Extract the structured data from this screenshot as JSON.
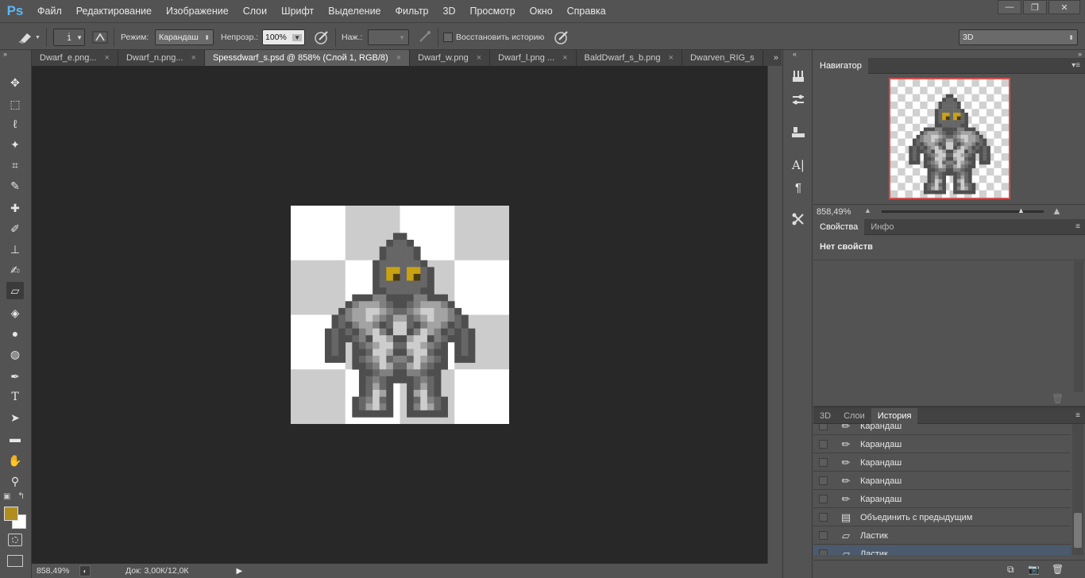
{
  "app": {
    "logo": "Ps"
  },
  "menu": [
    "Файл",
    "Редактирование",
    "Изображение",
    "Слои",
    "Шрифт",
    "Выделение",
    "Фильтр",
    "3D",
    "Просмотр",
    "Окно",
    "Справка"
  ],
  "window_controls": {
    "minimize": "—",
    "restore": "❐",
    "close": "✕"
  },
  "options": {
    "brush_size": "1",
    "mode_label": "Режим:",
    "mode_value": "Карандаш",
    "opacity_label": "Непрозр.:",
    "opacity_value": "100%",
    "pressure_label": "Наж.:",
    "pressure_value": "",
    "restore_history_label": "Восстановить историю",
    "restore_history_checked": false,
    "workspace": "3D"
  },
  "tabs": [
    {
      "label": "Dwarf_e.png...",
      "active": false
    },
    {
      "label": "Dwarf_n.png...",
      "active": false
    },
    {
      "label": "Spessdwarf_s.psd @ 858% (Слой 1, RGB/8)",
      "active": true
    },
    {
      "label": "Dwarf_w.png",
      "active": false
    },
    {
      "label": "Dwarf_l.png ...",
      "active": false
    },
    {
      "label": "BaldDwarf_s_b.png",
      "active": false
    },
    {
      "label": "Dwarven_RIG_s",
      "active": false
    }
  ],
  "tabs_overflow": "»",
  "status": {
    "zoom": "858,49%",
    "doc": "Док: 3,00К/12,0К"
  },
  "colors": {
    "foreground": "#b08d1e",
    "background": "#ffffff",
    "accent_selected": "#4c5a6e"
  },
  "navigator": {
    "tab": "Навигатор",
    "zoom": "858,49%",
    "zoom_slider_fraction": 0.86
  },
  "properties": {
    "tabs": [
      "Свойства",
      "Инфо"
    ],
    "empty_text": "Нет свойств"
  },
  "history": {
    "tabs": [
      "3D",
      "Слои",
      "История"
    ],
    "items": [
      {
        "label": "Карандаш",
        "icon": "pencil-icon",
        "selected": false
      },
      {
        "label": "Карандаш",
        "icon": "pencil-icon",
        "selected": false
      },
      {
        "label": "Карандаш",
        "icon": "pencil-icon",
        "selected": false
      },
      {
        "label": "Карандаш",
        "icon": "pencil-icon",
        "selected": false
      },
      {
        "label": "Карандаш",
        "icon": "pencil-icon",
        "selected": false
      },
      {
        "label": "Объединить с предыдущим",
        "icon": "document-icon",
        "selected": false
      },
      {
        "label": "Ластик",
        "icon": "eraser-icon",
        "selected": false
      },
      {
        "label": "Ластик",
        "icon": "eraser-icon",
        "selected": true
      }
    ]
  },
  "tools": [
    "move-tool",
    "marquee-tool",
    "lasso-tool",
    "magic-wand-tool",
    "crop-tool",
    "eyedropper-tool",
    "healing-brush-tool",
    "brush-tool",
    "clone-stamp-tool",
    "history-brush-tool",
    "eraser-tool",
    "paint-bucket-tool",
    "blur-tool",
    "dodge-tool",
    "pen-tool",
    "type-tool",
    "path-selection-tool",
    "rectangle-tool",
    "hand-tool",
    "zoom-tool"
  ],
  "sprite": {
    "palette": {
      "K": "#3a3a3a",
      "D": "#4e4e4e",
      "M": "#666666",
      "G": "#808080",
      "L": "#a3a3a3",
      "W": "#cdcdcd",
      "Y": "#c9a212",
      "B": "#4a3a10"
    },
    "rows": [
      "..........................",
      "..........................",
      "..........................",
      "..........................",
      "............DD............",
      "...........DMMD...........",
      "..........DMMMMD..........",
      "..........DMMMMD..........",
      ".........DMMMMMMD.........",
      ".........DMYYMYYMD........",
      ".........DMYBMYBMD........",
      ".........DMMMMMMMD........",
      ".........DDMMMMMDD........",
      "......DDDGGDDDDGGDDD......",
      ".....DGLLLGMDDMGLLLGD.....",
      "....DGLLWWLGMMGLWWLLGD....",
      "...DMGLLWLGMLLMGLWLLGMD...",
      "...DMDGLLGDMWWMDGLLGDMD...",
      "..DMDMDGLWGDWWDGWLGDMDMD..",
      "..DMDDMGDWWLDDLWWDGMDDMD..",
      "..DMD.DMGLWWMMWWLGMD.DMD..",
      "..DMD.DDMWWLDDLWWMDD.DMD..",
      "..DDD.DMGLWMGGMWLGMD.DDD..",
      "......DDMGWLMMLWGMDD......",
      ".......DDMGGDDGGMDD.......",
      ".......DMGMDDDDMGMD.......",
      ".......DMLMD..DMLMD.......",
      ".......DMWLD..DLWMD.......",
      "......DMGWMD..DMWGMD......",
      "......DMLWGD..DGWLMD......",
      "......DDDDDD..DDDDDD......",
      ".........................."
    ]
  }
}
